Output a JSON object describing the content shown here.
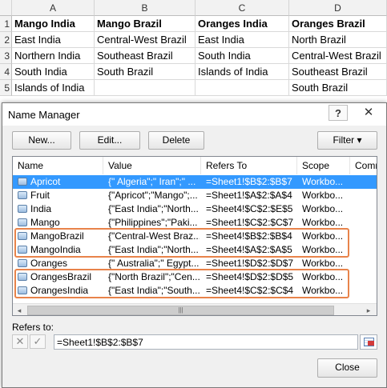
{
  "sheet": {
    "columns": [
      "A",
      "B",
      "C",
      "D"
    ],
    "rows": [
      "1",
      "2",
      "3",
      "4",
      "5"
    ],
    "headers": [
      "Mango India",
      "Mango Brazil",
      "Oranges India",
      "Oranges Brazil"
    ],
    "cells": [
      [
        "East India",
        "Central-West Brazil",
        "East India",
        "North Brazil"
      ],
      [
        "Northern India",
        "Southeast Brazil",
        "South India",
        "Central-West Brazil"
      ],
      [
        "South India",
        "South Brazil",
        "Islands of India",
        "Southeast Brazil"
      ],
      [
        "Islands of India",
        "",
        "",
        "South Brazil"
      ]
    ]
  },
  "dialog": {
    "title": "Name Manager",
    "help_label": "?",
    "close_glyph": "✕",
    "buttons": {
      "new": "New...",
      "edit": "Edit...",
      "delete": "Delete",
      "filter": "Filter"
    },
    "filter_arrow": "▾",
    "list": {
      "columns": [
        "Name",
        "Value",
        "Refers To",
        "Scope",
        "Comment"
      ],
      "rows": [
        {
          "name": "Apricot",
          "value": "{\" Algeria\";\" Iran\";\" ...",
          "refers_to": "=Sheet1!$B$2:$B$7",
          "scope": "Workbo...",
          "selected": true
        },
        {
          "name": "Fruit",
          "value": "{\"Apricot\";\"Mango\";...",
          "refers_to": "=Sheet1!$A$2:$A$4",
          "scope": "Workbo..."
        },
        {
          "name": "India",
          "value": "{\"East India\";\"North...",
          "refers_to": "=Sheet4!$C$2:$E$5",
          "scope": "Workbo..."
        },
        {
          "name": "Mango",
          "value": "{\"Philippines\";\"Paki...",
          "refers_to": "=Sheet1!$C$2:$C$7",
          "scope": "Workbo..."
        },
        {
          "name": "MangoBrazil",
          "value": "{\"Central-West Braz...",
          "refers_to": "=Sheet4!$B$2:$B$4",
          "scope": "Workbo..."
        },
        {
          "name": "MangoIndia",
          "value": "{\"East India\";\"North...",
          "refers_to": "=Sheet4!$A$2:$A$5",
          "scope": "Workbo..."
        },
        {
          "name": "Oranges",
          "value": "{\" Australia\";\" Egypt...",
          "refers_to": "=Sheet1!$D$2:$D$7",
          "scope": "Workbo..."
        },
        {
          "name": "OrangesBrazil",
          "value": "{\"North Brazil\";\"Cen...",
          "refers_to": "=Sheet4!$D$2:$D$5",
          "scope": "Workbo..."
        },
        {
          "name": "OrangesIndia",
          "value": "{\"East India\";\"South...",
          "refers_to": "=Sheet4!$C$2:$C$4",
          "scope": "Workbo..."
        }
      ],
      "scroll_left": "◂",
      "scroll_right": "▸",
      "scroll_grip": "|||"
    },
    "refers_to_label": "Refers to:",
    "cancel_glyph": "✕",
    "confirm_glyph": "✓",
    "refers_to_value": "=Sheet1!$B$2:$B$7",
    "close_label": "Close"
  },
  "colors": {
    "selection": "#3399ff",
    "highlight_border": "#e8834a"
  }
}
